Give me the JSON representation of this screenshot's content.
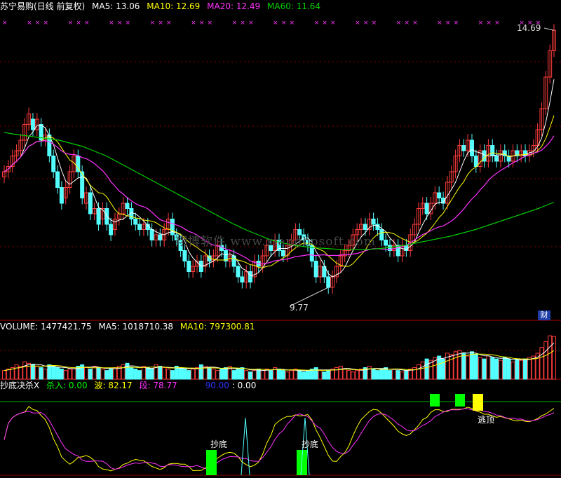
{
  "header": {
    "stock_name": "苏宁易购(日线 前复权)",
    "ma5_label": "MA5: 13.06",
    "ma10_label": "MA10: 12.69",
    "ma20_label": "MA20: 12.49",
    "ma60_label": "MA60: 11.64"
  },
  "volume_header": {
    "title": "VOLUME: 1477421.75",
    "ma5": "MA5: 1018710.38",
    "ma10": "MA10: 797300.81"
  },
  "indicator_header": {
    "title": "抄底决杀X",
    "kill": "杀入: 0.00",
    "wave": "波: 82.17",
    "segment": "段: 78.77",
    "level": "90.00",
    "level_value": ": 0.00"
  },
  "annotations": {
    "high_label": "14.69",
    "low_label": "9.77",
    "buy_label_1": "抄底",
    "buy_label_2": "抄底",
    "sell_label": "逃顶",
    "finance_button": "财",
    "watermark": "翔博软件 www.xiangbosoft.com"
  },
  "colors": {
    "up": "#ff3c3c",
    "down": "#54ffff",
    "ma5": "#ffffff",
    "ma10": "#ffff00",
    "ma20": "#ff33ff",
    "ma60": "#00d000",
    "panel_border": "#b00000",
    "buy_signal": "#00ff00",
    "sell_signal": "#ffff00"
  },
  "chart_data": {
    "type": "candlestick",
    "y_range": [
      9.4,
      14.8
    ],
    "high": 14.69,
    "low": 9.77,
    "closes": [
      12.0,
      12.1,
      12.3,
      12.4,
      12.6,
      12.9,
      13.1,
      12.8,
      13.0,
      12.6,
      12.7,
      12.3,
      12.0,
      11.7,
      11.4,
      11.7,
      12.0,
      12.3,
      12.0,
      11.5,
      11.6,
      11.2,
      11.3,
      11.0,
      11.3,
      11.0,
      10.8,
      11.1,
      11.2,
      11.4,
      11.3,
      11.1,
      11.0,
      10.9,
      11.0,
      10.9,
      10.7,
      10.8,
      10.7,
      10.9,
      11.1,
      10.8,
      10.7,
      10.5,
      10.3,
      10.1,
      10.2,
      10.3,
      10.1,
      10.4,
      10.3,
      10.4,
      10.6,
      10.5,
      10.3,
      10.4,
      10.2,
      10.0,
      9.9,
      10.1,
      9.9,
      10.3,
      10.2,
      10.4,
      10.6,
      10.5,
      10.7,
      10.5,
      10.4,
      10.6,
      10.7,
      10.9,
      10.8,
      10.7,
      10.6,
      10.3,
      10.0,
      10.2,
      10.0,
      9.8,
      10.0,
      10.2,
      10.4,
      10.5,
      10.6,
      10.8,
      10.9,
      11.0,
      10.9,
      11.1,
      11.0,
      10.9,
      10.7,
      10.6,
      10.5,
      10.6,
      10.4,
      10.6,
      10.5,
      10.8,
      11.0,
      11.3,
      11.4,
      11.2,
      11.4,
      11.6,
      11.5,
      11.4,
      11.8,
      12.0,
      12.3,
      12.5,
      12.4,
      12.6,
      12.3,
      12.1,
      12.4,
      12.2,
      12.5,
      12.3,
      12.2,
      12.4,
      12.3,
      12.2,
      12.4,
      12.3,
      12.4,
      12.3,
      12.4,
      12.5,
      12.8,
      13.2,
      13.8,
      14.3,
      14.69
    ],
    "opens": [
      11.9,
      12.0,
      12.1,
      12.3,
      12.4,
      12.6,
      12.9,
      13.0,
      12.8,
      12.9,
      12.6,
      12.7,
      12.3,
      12.0,
      11.7,
      11.5,
      11.7,
      12.0,
      12.3,
      12.0,
      11.4,
      11.6,
      11.2,
      11.3,
      11.1,
      11.3,
      11.0,
      10.9,
      11.1,
      11.2,
      11.4,
      11.3,
      11.1,
      11.0,
      10.9,
      11.0,
      10.9,
      10.7,
      10.8,
      10.7,
      10.9,
      11.1,
      10.8,
      10.7,
      10.5,
      10.3,
      10.1,
      10.2,
      10.3,
      10.2,
      10.4,
      10.3,
      10.4,
      10.6,
      10.5,
      10.3,
      10.4,
      10.2,
      10.0,
      9.9,
      10.1,
      10.0,
      10.3,
      10.2,
      10.4,
      10.6,
      10.5,
      10.7,
      10.5,
      10.4,
      10.6,
      10.7,
      10.9,
      10.8,
      10.7,
      10.6,
      10.3,
      10.0,
      10.2,
      10.0,
      9.8,
      10.0,
      10.2,
      10.4,
      10.5,
      10.6,
      10.8,
      10.9,
      11.0,
      10.9,
      11.1,
      11.0,
      10.9,
      10.7,
      10.6,
      10.5,
      10.6,
      10.4,
      10.6,
      10.5,
      10.8,
      11.0,
      11.3,
      11.4,
      11.2,
      11.4,
      11.6,
      11.5,
      11.4,
      11.8,
      12.0,
      12.3,
      12.5,
      12.4,
      12.6,
      12.3,
      12.1,
      12.4,
      12.2,
      12.5,
      12.3,
      12.2,
      12.4,
      12.3,
      12.2,
      12.4,
      12.3,
      12.4,
      12.3,
      12.4,
      12.5,
      12.8,
      13.2,
      13.8,
      14.3
    ],
    "ma60": [
      12.75,
      12.72,
      12.7,
      12.68,
      12.66,
      12.64,
      12.62,
      12.6,
      12.56,
      12.52,
      12.48,
      12.42,
      12.36,
      12.3,
      12.22,
      12.14,
      12.06,
      11.98,
      11.9,
      11.82,
      11.74,
      11.66,
      11.58,
      11.5,
      11.42,
      11.34,
      11.26,
      11.18,
      11.1,
      11.02,
      10.95,
      10.88,
      10.82,
      10.76,
      10.7,
      10.66,
      10.63,
      10.6,
      10.58,
      10.56,
      10.55,
      10.54,
      10.53,
      10.52,
      10.52,
      10.52,
      10.52,
      10.53,
      10.54,
      10.56,
      10.58,
      10.6,
      10.63,
      10.66,
      10.69,
      10.72,
      10.75,
      10.78,
      10.82,
      10.86,
      10.9,
      10.95,
      11.0,
      11.05,
      11.1,
      11.15,
      11.2,
      11.25,
      11.3,
      11.36,
      11.42
    ],
    "volumes": [
      0.3,
      0.35,
      0.4,
      0.5,
      0.45,
      0.6,
      0.55,
      0.5,
      0.45,
      0.4,
      0.35,
      0.5,
      0.45,
      0.4,
      0.35,
      0.3,
      0.35,
      0.4,
      0.45,
      0.5,
      0.4,
      0.35,
      0.45,
      0.4,
      0.35,
      0.3,
      0.35,
      0.4,
      0.45,
      0.5,
      0.55,
      0.4,
      0.35,
      0.3,
      0.45,
      0.4,
      0.35,
      0.5,
      0.45,
      0.4,
      0.35,
      0.3,
      0.45,
      0.4,
      0.35,
      0.3,
      0.35,
      0.4,
      0.5,
      0.45,
      0.4,
      0.35,
      0.3,
      0.35,
      0.4,
      0.45,
      0.3,
      0.35,
      0.4,
      0.3,
      0.25,
      0.3,
      0.35,
      0.3,
      0.35,
      0.3,
      0.4,
      0.35,
      0.3,
      0.25,
      0.3,
      0.35,
      0.3,
      0.25,
      0.3,
      0.35,
      0.4,
      0.3,
      0.25,
      0.3,
      0.35,
      0.4,
      0.45,
      0.35,
      0.3,
      0.25,
      0.3,
      0.35,
      0.4,
      0.45,
      0.35,
      0.3,
      0.35,
      0.4,
      0.3,
      0.35,
      0.3,
      0.25,
      0.3,
      0.35,
      0.4,
      0.5,
      0.6,
      0.7,
      0.65,
      0.75,
      0.8,
      0.7,
      0.9,
      0.85,
      0.95,
      1.0,
      0.9,
      0.8,
      0.95,
      0.85,
      0.75,
      0.7,
      0.8,
      0.75,
      0.7,
      0.65,
      0.75,
      0.7,
      0.6,
      0.7,
      0.65,
      0.7,
      0.75,
      0.8,
      0.9,
      1.1,
      1.3,
      1.5,
      1.48
    ],
    "signals": {
      "buy_bars_x": [
        301,
        430
      ],
      "sell_green_bars_x": [
        620,
        656
      ],
      "sell_yellow_bar_x": [
        681
      ],
      "spikes_x": [
        350,
        435
      ]
    }
  }
}
